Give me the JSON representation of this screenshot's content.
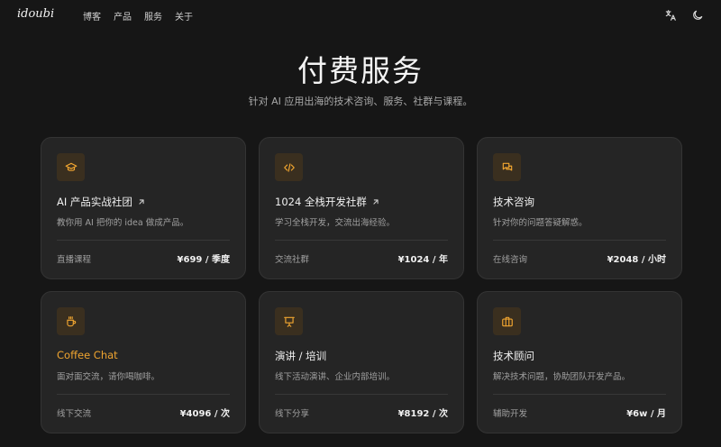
{
  "nav": {
    "logo": "idoubi",
    "links": [
      "博客",
      "产品",
      "服务",
      "关于"
    ],
    "icons": [
      "translate-icon",
      "moon-icon"
    ]
  },
  "hero": {
    "title": "付费服务",
    "subtitle": "针对 AI 应用出海的技术咨询、服务、社群与课程。"
  },
  "colors": {
    "accent": "#f0a530",
    "background": "#161616",
    "card": "#252525"
  },
  "cards": [
    {
      "icon": "graduation-cap-icon",
      "title": "AI 产品实战社团",
      "external": true,
      "desc": "教你用 AI 把你的 idea 做成产品。",
      "label": "直播课程",
      "price": "¥699 / 季度"
    },
    {
      "icon": "code-icon",
      "title": "1024 全栈开发社群",
      "external": true,
      "desc": "学习全栈开发，交流出海经验。",
      "label": "交流社群",
      "price": "¥1024 / 年"
    },
    {
      "icon": "chat-bubbles-icon",
      "title": "技术咨询",
      "external": false,
      "desc": "针对你的问题答疑解惑。",
      "label": "在线咨询",
      "price": "¥2048 / 小时"
    },
    {
      "icon": "coffee-cup-icon",
      "title": "Coffee Chat",
      "external": false,
      "desc": "面对面交流，请你喝咖啡。",
      "label": "线下交流",
      "price": "¥4096 / 次"
    },
    {
      "icon": "presentation-icon",
      "title": "演讲 / 培训",
      "external": false,
      "desc": "线下活动演讲、企业内部培训。",
      "label": "线下分享",
      "price": "¥8192 / 次"
    },
    {
      "icon": "briefcase-icon",
      "title": "技术顾问",
      "external": false,
      "desc": "解决技术问题，协助团队开发产品。",
      "label": "辅助开发",
      "price": "¥6w / 月"
    }
  ]
}
